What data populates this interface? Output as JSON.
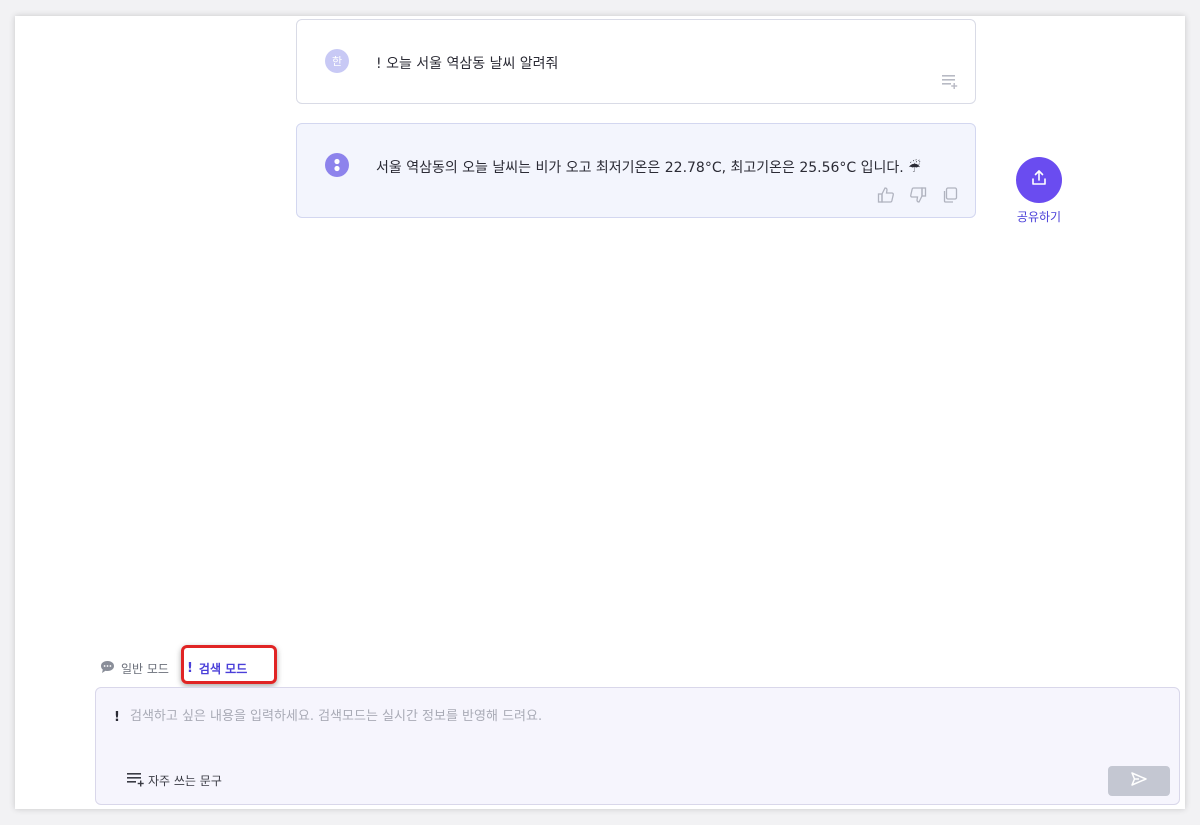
{
  "messages": {
    "user": {
      "avatar": "한",
      "text": "! 오늘 서울 역삼동 날씨 알려줘",
      "action_icon": "add-to-phrases-icon"
    },
    "bot": {
      "text": "서울 역삼동의 오늘 날씨는 비가 오고 최저기온은 22.78°C, 최고기온은 25.56°C 입니다. ☔",
      "actions": [
        "thumbs-up-icon",
        "thumbs-down-icon",
        "copy-icon"
      ]
    }
  },
  "share": {
    "label": "공유하기"
  },
  "modes": {
    "general": {
      "label": "일반 모드",
      "icon": "chat-bubble-icon"
    },
    "search": {
      "label": "검색 모드",
      "prefix": "!"
    }
  },
  "input": {
    "prefix": "!",
    "placeholder": "검색하고 싶은 내용을 입력하세요. 검색모드는 실시간 정보를 반영해 드려요.",
    "value": ""
  },
  "phrases_button": {
    "label": "자주 쓰는 문구"
  },
  "colors": {
    "accent": "#6a4cf0",
    "highlight": "#e02424",
    "send_disabled": "#c4c7d2"
  }
}
